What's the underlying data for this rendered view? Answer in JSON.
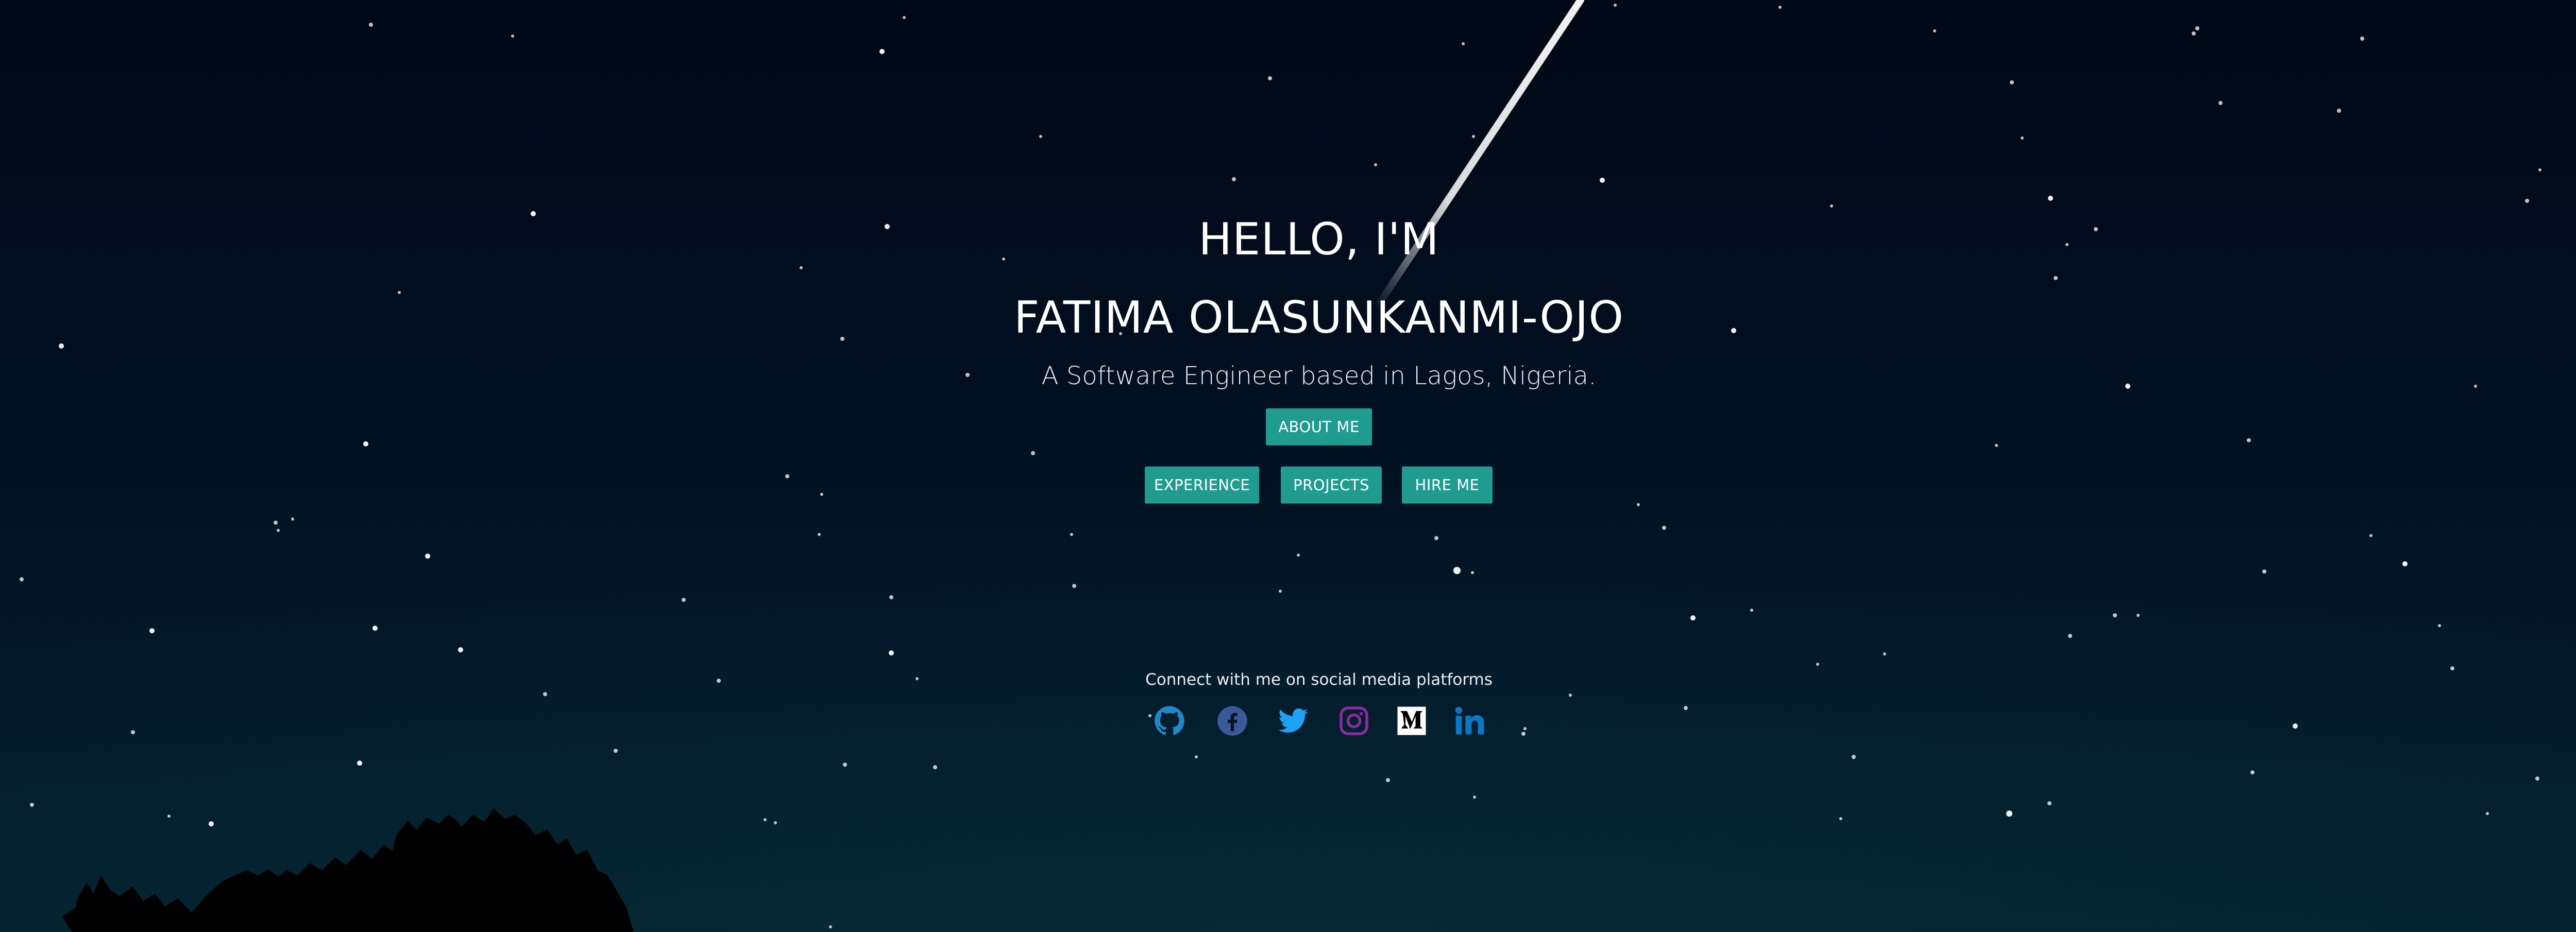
{
  "hero": {
    "greeting": "HELLO, I'M",
    "name": "FATIMA OLASUNKANMI-OJO",
    "tagline": "A Software Engineer based in Lagos, Nigeria."
  },
  "buttons": {
    "about": "ABOUT ME",
    "experience": "EXPERIENCE",
    "projects": "PROJECTS",
    "hire": "HIRE ME"
  },
  "social": {
    "caption": "Connect with me on social media platforms",
    "links": [
      {
        "icon": "github-icon",
        "color": "#1e88c8"
      },
      {
        "icon": "facebook-icon",
        "color": "#3b5998"
      },
      {
        "icon": "twitter-icon",
        "color": "#1da1f2"
      },
      {
        "icon": "instagram-icon",
        "color": "#8a2aa0"
      },
      {
        "icon": "medium-icon",
        "color": "#ffffff"
      },
      {
        "icon": "linkedin-icon",
        "color": "#0a78c2"
      }
    ]
  },
  "colors": {
    "accent": "#1f9c8f",
    "background_top": "#010816",
    "background_bottom": "#04202d"
  }
}
